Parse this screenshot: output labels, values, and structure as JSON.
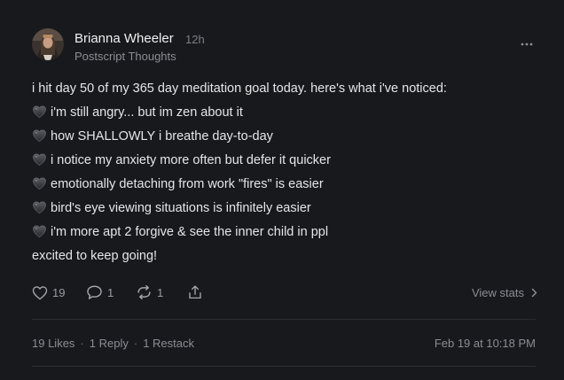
{
  "post": {
    "author": {
      "name": "Brianna Wheeler",
      "time": "12h",
      "publication": "Postscript Thoughts"
    },
    "body": {
      "intro": "i hit day 50 of my 365 day meditation goal today. here's what i've noticed:",
      "bullet_icon": "black-heart",
      "bullets": [
        "i'm still angry... but im zen about it",
        "how SHALLOWLY i breathe day-to-day",
        "i notice my anxiety more often but defer it quicker",
        "emotionally detaching from work \"fires\" is easier",
        "bird's eye viewing situations is infinitely easier",
        "i'm more apt 2 forgive & see the inner child in ppl"
      ],
      "outro": "excited to keep going!"
    },
    "actions": {
      "like_count": "19",
      "reply_count": "1",
      "restack_count": "1",
      "view_stats_label": "View stats"
    },
    "meta": {
      "likes": "19 Likes",
      "replies": "1 Reply",
      "restacks": "1 Restack",
      "separator": "·",
      "date": "Feb 19 at 10:18 PM"
    }
  },
  "colors": {
    "background": "#18191c",
    "text": "#e6e6e8",
    "muted": "#8b8d94",
    "divider": "#2c2d31"
  }
}
